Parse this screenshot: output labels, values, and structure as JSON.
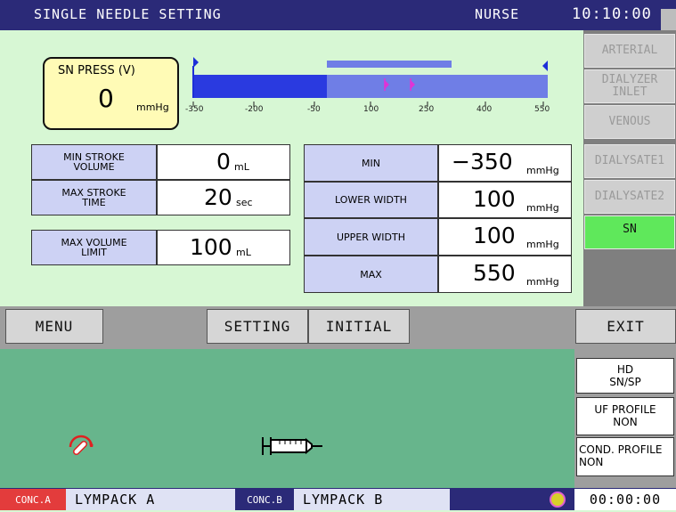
{
  "header": {
    "title": "SINGLE NEEDLE SETTING",
    "user": "NURSE",
    "clock": "10:10:00"
  },
  "pressure": {
    "label": "SN PRESS (V)",
    "value": "0",
    "unit": "mmHg",
    "ticks": [
      "-350",
      "-200",
      "-50",
      "100",
      "250",
      "400",
      "550"
    ]
  },
  "left_params": [
    {
      "label_line1": "MIN STROKE",
      "label_line2": "VOLUME",
      "value": "0",
      "unit": "mL"
    },
    {
      "label_line1": "MAX STROKE",
      "label_line2": "TIME",
      "value": "20",
      "unit": "sec"
    },
    {
      "label_line1": "MAX VOLUME",
      "label_line2": "LIMIT",
      "value": "100",
      "unit": "mL"
    }
  ],
  "right_params": [
    {
      "label": "MIN",
      "value": "−350",
      "unit": "mmHg"
    },
    {
      "label": "LOWER WIDTH",
      "value": "100",
      "unit": "mmHg"
    },
    {
      "label": "UPPER WIDTH",
      "value": "100",
      "unit": "mmHg"
    },
    {
      "label": "MAX",
      "value": "550",
      "unit": "mmHg"
    }
  ],
  "side_tabs": [
    {
      "label_line1": "ARTERIAL",
      "label_line2": ""
    },
    {
      "label_line1": "DIALYZER",
      "label_line2": "INLET"
    },
    {
      "label_line1": "VENOUS",
      "label_line2": ""
    },
    {
      "label_line1": "DIALYSATE1",
      "label_line2": ""
    },
    {
      "label_line1": "DIALYSATE2",
      "label_line2": ""
    },
    {
      "label_line1": "SN",
      "label_line2": ""
    }
  ],
  "menu": {
    "menu": "MENU",
    "setting": "SETTING",
    "initial": "INITIAL",
    "exit": "EXIT"
  },
  "info": {
    "mode_line1": "HD",
    "mode_line2": "SN/SP",
    "uf_line1": "UF PROFILE",
    "uf_line2": "NON",
    "cond_line1": "COND. PROFILE",
    "cond_line2": "NON"
  },
  "status": {
    "conc_a_tag": "CONC.A",
    "conc_a": "LYMPACK A",
    "conc_b_tag": "CONC.B",
    "conc_b": "LYMPACK B",
    "timer": "00:00:00"
  },
  "icons": [
    "heparin-pump-icon",
    "syringe-icon",
    "status-indicator-icon"
  ],
  "colors": {
    "header": "#2b2a78",
    "background": "#d7f7d4",
    "active_tab": "#5fe85b",
    "bar": "#3c4fe0",
    "marker": "#e033d6",
    "lower_panel": "#67b58c"
  }
}
